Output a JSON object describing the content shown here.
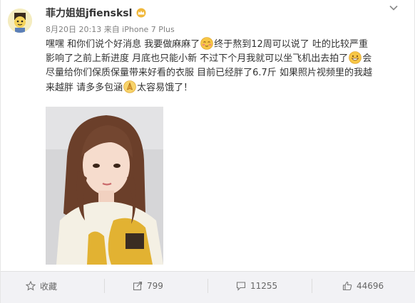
{
  "post": {
    "author": "菲力姐姐jfiensksl",
    "meta": "8月20日 20:13 来自 iPhone 7 Plus",
    "lines": [
      {
        "a": "嘿嘿 和你们说个好消息 我要做麻麻了",
        "b": "终于熬到12周可以说了 吐的比较严重"
      },
      {
        "a": "影响了之前上新进度 月底也只能小新 不过下个月我就可以坐飞机出去拍了",
        "b": "会"
      },
      {
        "a": "尽量给你们保质保量带来好看的衣服 目前已经胖了6.7斤 如果照片视频里的我越",
        "b": ""
      },
      {
        "a": "来越胖 请多多包涵",
        "b": "太容易饿了！"
      }
    ]
  },
  "actions": {
    "favorite": "收藏",
    "repost_count": "799",
    "comment_count": "11255",
    "like_count": "44696"
  },
  "colors": {
    "accent_gold": "#e8a92b",
    "footer_bg": "#f2f2f5"
  }
}
